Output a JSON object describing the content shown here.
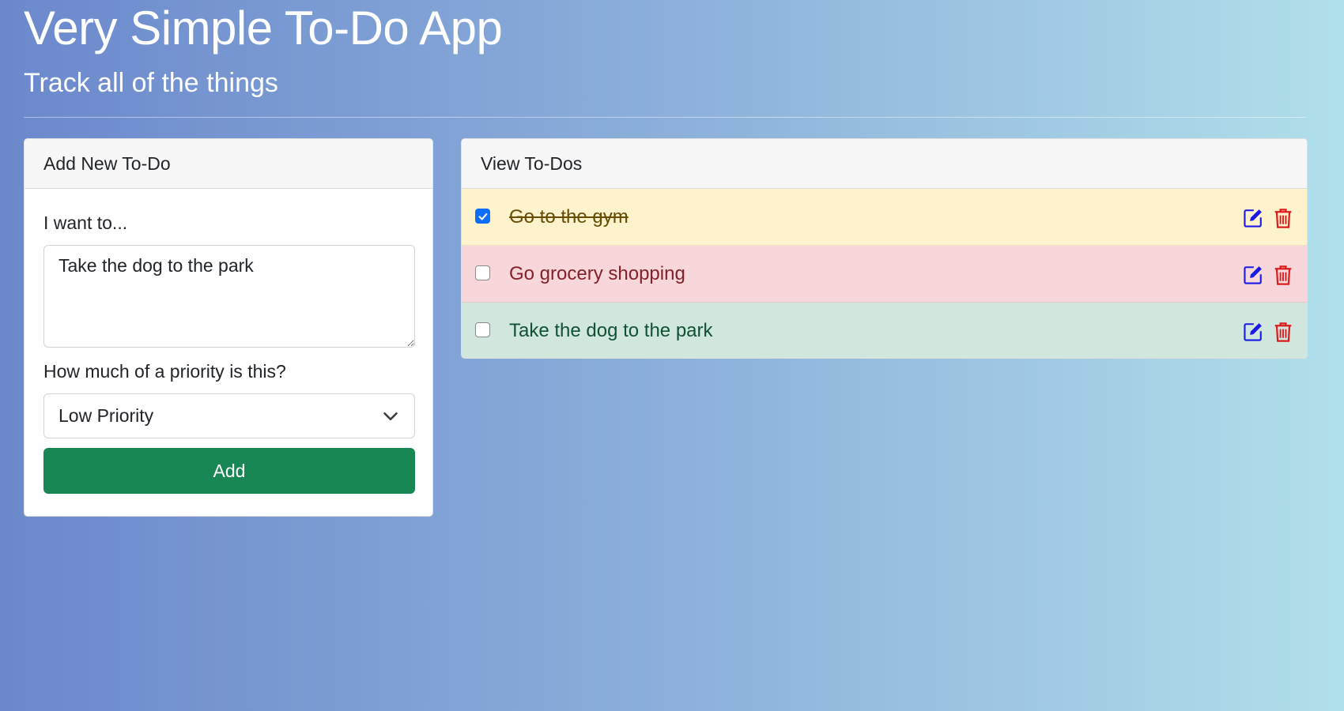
{
  "header": {
    "title": "Very Simple To-Do App",
    "subtitle": "Track all of the things"
  },
  "add_card": {
    "title": "Add New To-Do",
    "description_label": "I want to...",
    "description_value": "Take the dog to the park",
    "priority_label": "How much of a priority is this?",
    "priority_selected": "Low Priority",
    "add_button_label": "Add"
  },
  "view_card": {
    "title": "View To-Dos",
    "todos": [
      {
        "text": "Go to the gym",
        "completed": true,
        "row_color": "#fff3cd",
        "text_color": "#664d03"
      },
      {
        "text": "Go grocery shopping",
        "completed": false,
        "row_color": "#f8d7da",
        "text_color": "#842029"
      },
      {
        "text": "Take the dog to the park",
        "completed": false,
        "row_color": "#d1e7dd",
        "text_color": "#0f5132"
      }
    ]
  },
  "colors": {
    "add_button": "#198754",
    "edit_icon": "#1a1ae6",
    "delete_icon": "#dc1c1c",
    "checkbox_checked": "#0d6efd"
  },
  "icons": {
    "edit": "pencil-square-icon",
    "delete": "trash-icon",
    "select": "chevron-down-icon"
  }
}
